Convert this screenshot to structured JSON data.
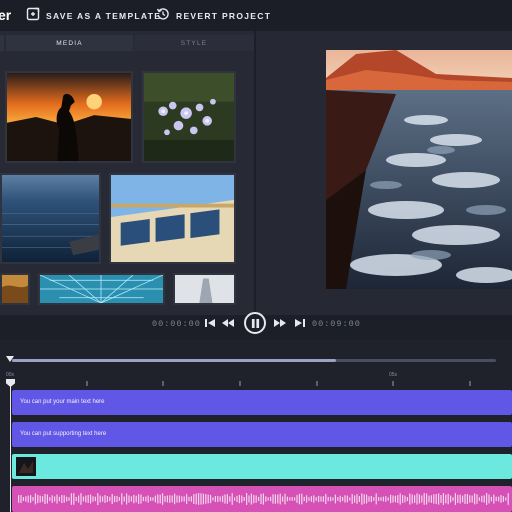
{
  "toolbar": {
    "logo_tail": "er",
    "save_template_label": "SAVE AS A TEMPLATE",
    "revert_label": "REVERT PROJECT"
  },
  "media_panel": {
    "tabs": [
      {
        "label": "MEDIA",
        "active": true
      },
      {
        "label": "STYLE",
        "active": false
      }
    ],
    "thumbnails": [
      {
        "subject": "dog silhouette at sunset"
      },
      {
        "subject": "flowers"
      },
      {
        "subject": "sea with pier"
      },
      {
        "subject": "glass building"
      },
      {
        "subject": "desert"
      },
      {
        "subject": "glass dome"
      },
      {
        "subject": "tower"
      }
    ]
  },
  "preview": {
    "subject": "river rapids at sunset"
  },
  "transport": {
    "current_time": "00:00:00",
    "total_time": "00:09:00",
    "controls": [
      "skip-back",
      "rewind",
      "pause",
      "fast-forward",
      "skip-forward"
    ]
  },
  "timeline": {
    "scrub_progress": 0.67,
    "ruler": {
      "start_label": "00s",
      "mid_label": "05s"
    },
    "tracks": [
      {
        "type": "text",
        "text": "You can put your main text here",
        "color": "#6157e6"
      },
      {
        "type": "text",
        "text": "You can put supporting text here",
        "color": "#6157e6"
      },
      {
        "type": "video",
        "color": "#6ce9de"
      },
      {
        "type": "audio",
        "color": "#d651b5"
      }
    ]
  },
  "colors": {
    "accent_text_track": "#6157e6",
    "video_track": "#6ce9de",
    "audio_track": "#d651b5",
    "background": "#1c1f28"
  }
}
